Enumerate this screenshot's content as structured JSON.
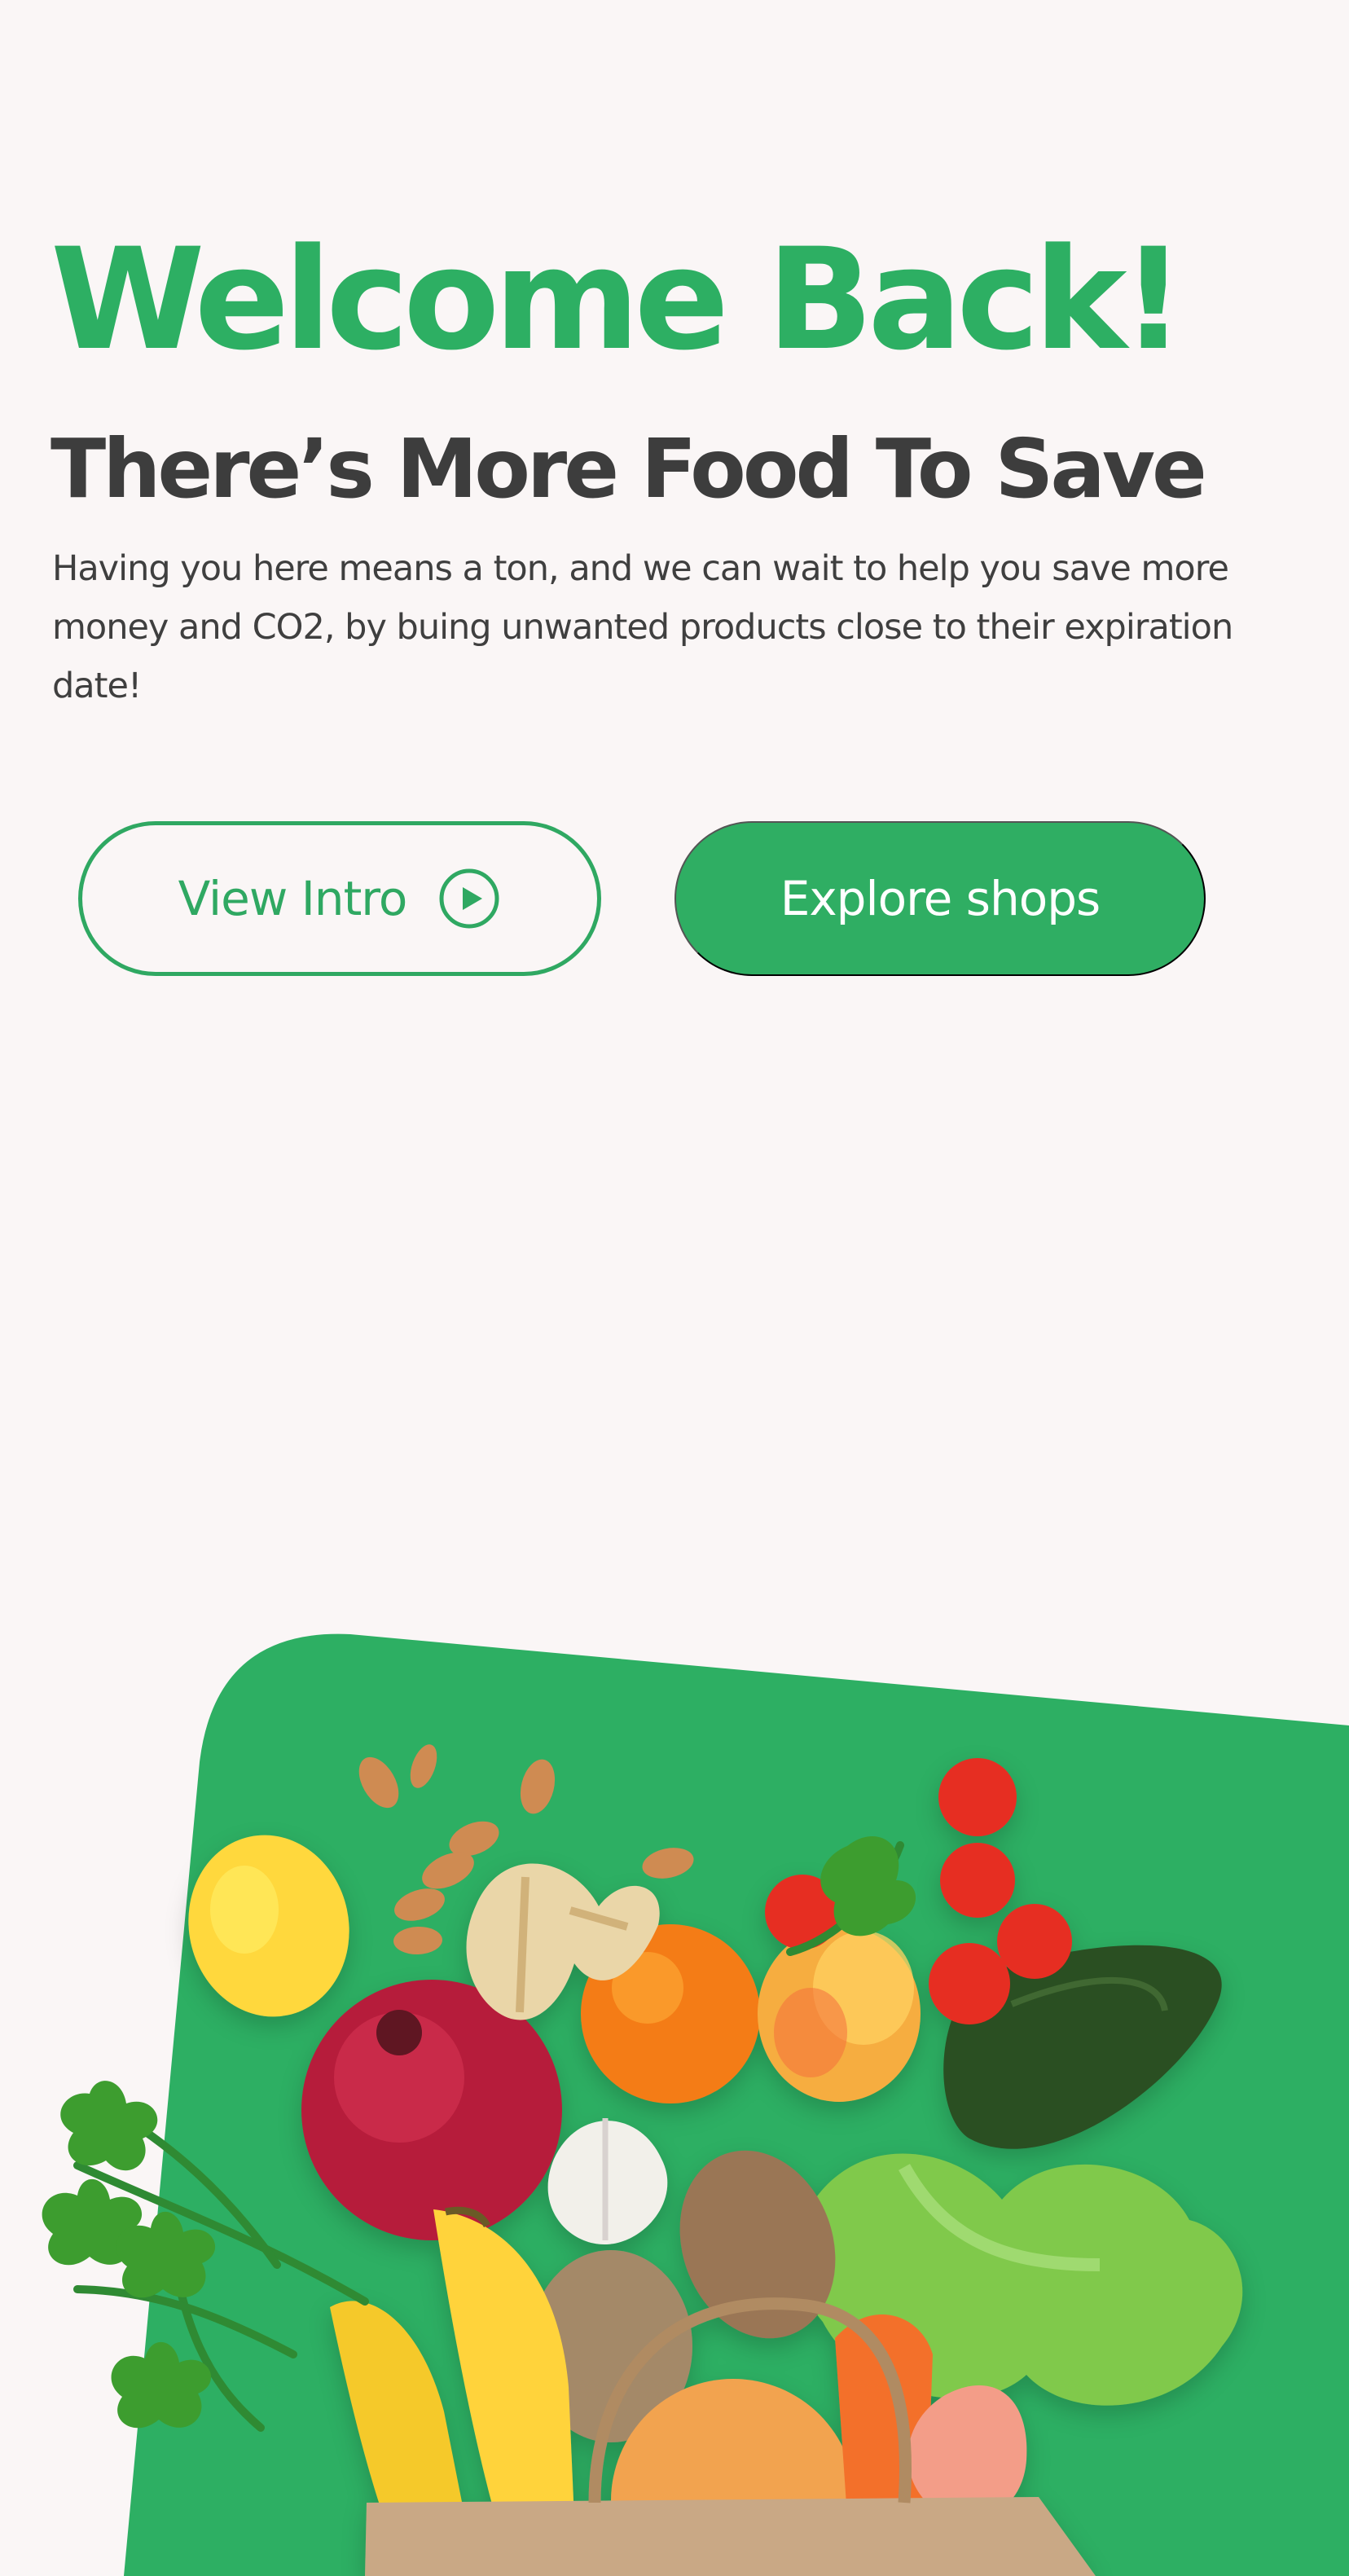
{
  "hero": {
    "title": "Welcome Back!",
    "subtitle": "There’s More Food To Save",
    "description": "Having you here means a ton, and we can wait to help you save more money and CO2, by buing unwanted products close to their expiration date!"
  },
  "actions": {
    "view_intro_label": "View Intro",
    "explore_label": "Explore shops"
  },
  "colors": {
    "brand_green": "#2faf64",
    "heading_dark": "#3d3d3d",
    "background": "#faf6f6"
  },
  "icons": {
    "intro_icon": "play-circle-icon"
  }
}
